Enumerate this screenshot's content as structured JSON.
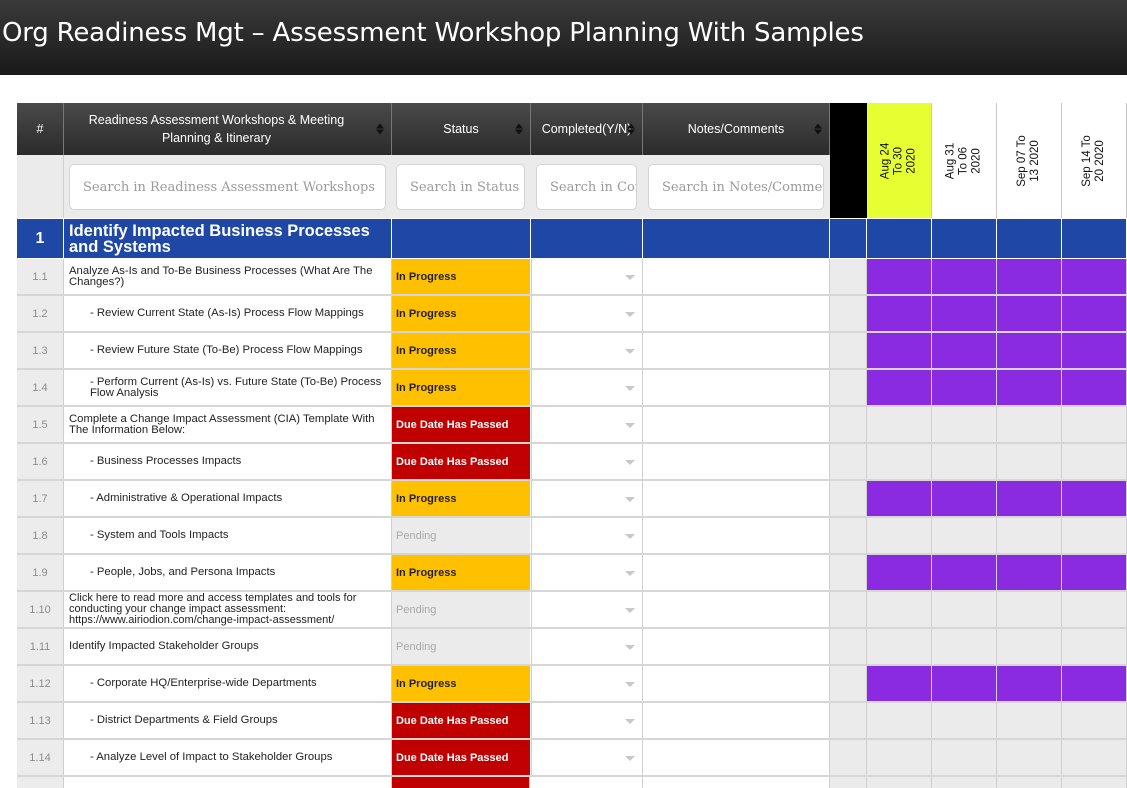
{
  "title": "Org Readiness Mgt – Assessment Workshop Planning With Samples",
  "columns": {
    "num": "#",
    "workshops": "Readiness Assessment Workshops & Meeting Planning & Itinerary",
    "status": "Status",
    "completed": "Completed(Y/N)",
    "notes": "Notes/Comments"
  },
  "search": {
    "workshops": "Search in Readiness Assessment Workshops",
    "status": "Search in Status",
    "completed": "Search in Completed(Y/N)",
    "notes": "Search in Notes/Comments"
  },
  "weeks": [
    {
      "line1": "Aug 24",
      "line2": "To 30",
      "line3": "2020",
      "highlight": true
    },
    {
      "line1": "Aug 31",
      "line2": "To 06",
      "line3": "2020",
      "highlight": false
    },
    {
      "line1": "Sep 07 To",
      "line2": "13 2020",
      "line3": "",
      "highlight": false
    },
    {
      "line1": "Sep 14 To",
      "line2": "20 2020",
      "line3": "",
      "highlight": false
    }
  ],
  "colors": {
    "in_progress": "#ffc000",
    "due_passed": "#c00000",
    "pending": "#ebebeb",
    "section": "#1f48a6",
    "gantt_on": "#8a2be2",
    "week_highlight": "#e6ff33"
  },
  "section": {
    "number": "1",
    "title": "Identify Impacted Business Processes and Systems"
  },
  "rows": [
    {
      "num": "1.1",
      "task": "Analyze As-Is and To-Be Business Processes (What Are The Changes?)",
      "indent": false,
      "status": "In Progress",
      "kind": "prog",
      "gantt": [
        true,
        true,
        true,
        true
      ]
    },
    {
      "num": "1.2",
      "task": "- Review Current State (As-Is) Process Flow Mappings",
      "indent": true,
      "status": "In Progress",
      "kind": "prog",
      "gantt": [
        true,
        true,
        true,
        true
      ]
    },
    {
      "num": "1.3",
      "task": "- Review Future State (To-Be) Process Flow Mappings",
      "indent": true,
      "status": "In Progress",
      "kind": "prog",
      "gantt": [
        true,
        true,
        true,
        true
      ]
    },
    {
      "num": "1.4",
      "task": "- Perform Current (As-Is) vs. Future State (To-Be) Process Flow Analysis",
      "indent": true,
      "status": "In Progress",
      "kind": "prog",
      "gantt": [
        true,
        true,
        true,
        true
      ]
    },
    {
      "num": "1.5",
      "task": "Complete a Change Impact Assessment (CIA) Template With The Information Below:",
      "indent": false,
      "status": "Due Date Has Passed",
      "kind": "due",
      "gantt": [
        false,
        false,
        false,
        false
      ]
    },
    {
      "num": "1.6",
      "task": "- Business Processes Impacts",
      "indent": true,
      "status": "Due Date Has Passed",
      "kind": "due",
      "gantt": [
        false,
        false,
        false,
        false
      ]
    },
    {
      "num": "1.7",
      "task": "- Administrative & Operational Impacts",
      "indent": true,
      "status": "In Progress",
      "kind": "prog",
      "gantt": [
        true,
        true,
        true,
        true
      ]
    },
    {
      "num": "1.8",
      "task": "- System and Tools Impacts",
      "indent": true,
      "status": "Pending",
      "kind": "pend",
      "gantt": [
        false,
        false,
        false,
        false
      ]
    },
    {
      "num": "1.9",
      "task": "- People, Jobs, and Persona Impacts",
      "indent": true,
      "status": "In Progress",
      "kind": "prog",
      "gantt": [
        true,
        true,
        true,
        true
      ]
    },
    {
      "num": "1.10",
      "task": "Click here to read more and access templates and tools for conducting your change impact assessment: https://www.airiodion.com/change-impact-assessment/",
      "indent": false,
      "status": "Pending",
      "kind": "pend",
      "gantt": [
        false,
        false,
        false,
        false
      ]
    },
    {
      "num": "1.11",
      "task": "Identify Impacted Stakeholder Groups",
      "indent": false,
      "status": "Pending",
      "kind": "pend",
      "gantt": [
        false,
        false,
        false,
        false
      ]
    },
    {
      "num": "1.12",
      "task": "- Corporate HQ/Enterprise-wide Departments",
      "indent": true,
      "status": "In Progress",
      "kind": "prog",
      "gantt": [
        true,
        true,
        true,
        true
      ]
    },
    {
      "num": "1.13",
      "task": "- District Departments & Field Groups",
      "indent": true,
      "status": "Due Date Has Passed",
      "kind": "due",
      "gantt": [
        false,
        false,
        false,
        false
      ]
    },
    {
      "num": "1.14",
      "task": "- Analyze Level of Impact to Stakeholder Groups",
      "indent": true,
      "status": "Due Date Has Passed",
      "kind": "due",
      "gantt": [
        false,
        false,
        false,
        false
      ]
    }
  ]
}
